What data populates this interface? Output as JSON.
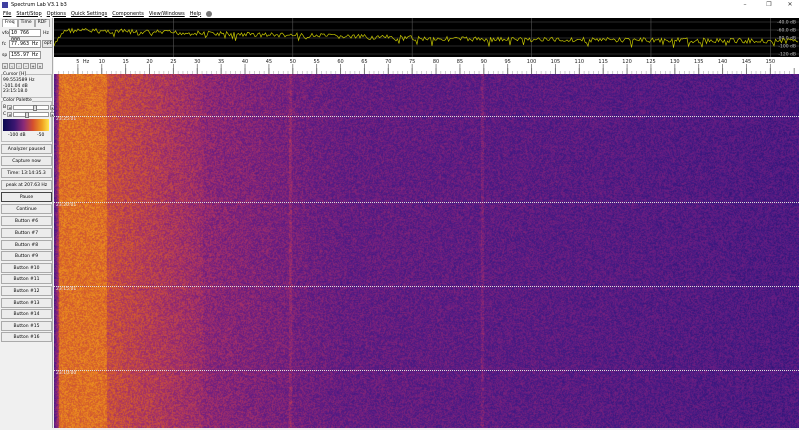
{
  "window": {
    "title": "Spectrum Lab V3.1 b3",
    "minimize": "–",
    "restore": "❐",
    "close": "✕"
  },
  "menu": [
    "File",
    "Start/Stop",
    "Options",
    "Quick Settings",
    "Components",
    "View/Windows",
    "Help"
  ],
  "left": {
    "tabs": [
      "Freq",
      "Time",
      "RDF"
    ],
    "vfo": {
      "label": "vfo",
      "value": "10 766 000",
      "unit": "Hz"
    },
    "fc": {
      "label": "fc",
      "value": "77.963 Hz",
      "button": "opt"
    },
    "sp": {
      "label": "sp",
      "value": "155.97 Hz"
    },
    "nav_buttons": [
      "«",
      "‹",
      "◦",
      "-",
      "+",
      "»"
    ],
    "cursor": {
      "title": "Cursor [H]",
      "freq": "99.553589 Hz",
      "level": "-101.04 dB",
      "time": "23:15:18.0"
    },
    "palette": {
      "title": "Color Palette",
      "b": "B",
      "c": "C",
      "b_level": 0.6,
      "c_level": 0.35,
      "min_label": "-100 dB",
      "max_label": "-50"
    },
    "buttons": [
      "Analyzer paused",
      "Capture now",
      "Time:  13:14:35.3",
      "peak at 207.63 Hz",
      "Pause",
      "Continue",
      "Button #6",
      "Button #7",
      "Button #8",
      "Button #9",
      "Button #10",
      "Button #11",
      "Button #12",
      "Button #13",
      "Button #14",
      "Button #15",
      "Button #16"
    ]
  },
  "spectrum": {
    "db_labels": [
      "-40.0 dB",
      "-60.0 dB",
      "-80.0 dB",
      "-100 dB",
      "-120 dB"
    ],
    "trace_color": "#c8c800"
  },
  "chart_data": {
    "type": "line",
    "x_ticks": [
      "5",
      "10",
      "15",
      "20",
      "25",
      "30",
      "35",
      "40",
      "45",
      "50",
      "55",
      "60",
      "65",
      "70",
      "75",
      "80",
      "85",
      "90",
      "95",
      "100",
      "105",
      "110",
      "115",
      "120",
      "125",
      "130",
      "135",
      "140",
      "145",
      "150"
    ],
    "x_unit": "Hz",
    "xlim": [
      0,
      156
    ],
    "ylim": [
      -125,
      -35
    ]
  },
  "waterfall": {
    "time_labels": [
      "23:25:01",
      "23:20:01",
      "23:15:01",
      "23:10:00"
    ]
  }
}
